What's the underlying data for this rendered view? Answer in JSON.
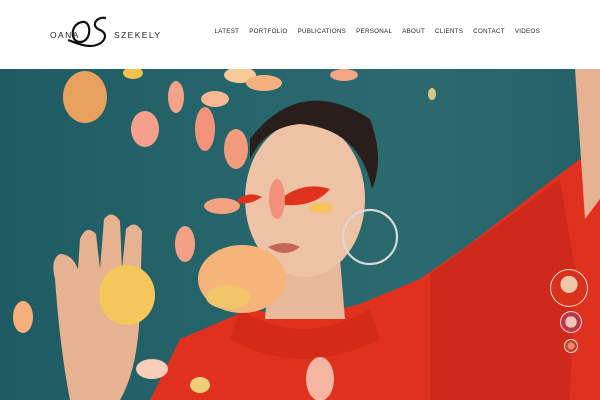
{
  "site": {
    "first_name": "OANA",
    "last_name": "SZEKELY",
    "monogram": "OS"
  },
  "nav": {
    "items": [
      {
        "label": "LATEST"
      },
      {
        "label": "PORTFOLIO"
      },
      {
        "label": "PUBLICATIONS"
      },
      {
        "label": "PERSONAL"
      },
      {
        "label": "ABOUT"
      },
      {
        "label": "CLIENTS"
      },
      {
        "label": "CONTACT"
      },
      {
        "label": "VIDEOS"
      }
    ]
  },
  "hero": {
    "background": "#26656b",
    "accent": "#e0311e"
  },
  "gallery": {
    "thumbnails": [
      {
        "name": "thumb-1"
      },
      {
        "name": "thumb-2"
      },
      {
        "name": "thumb-3"
      }
    ]
  }
}
